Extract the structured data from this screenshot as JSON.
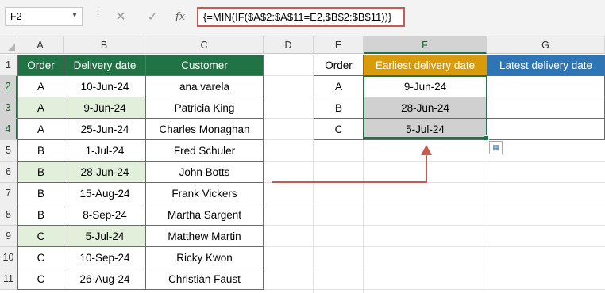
{
  "formula_bar": {
    "name_box": "F2",
    "cancel_icon": "✕",
    "enter_icon": "✓",
    "fx_label": "fx",
    "formula": "{=MIN(IF($A$2:$A$11=E2,$B$2:$B$11))}"
  },
  "columns": [
    "A",
    "B",
    "C",
    "D",
    "E",
    "F",
    "G"
  ],
  "rows": [
    "1",
    "2",
    "3",
    "4",
    "5",
    "6",
    "7",
    "8",
    "9",
    "10",
    "11"
  ],
  "left_table": {
    "headers": [
      "Order",
      "Delivery date",
      "Customer"
    ],
    "rows": [
      [
        "A",
        "10-Jun-24",
        "ana varela"
      ],
      [
        "A",
        "9-Jun-24",
        "Patricia King"
      ],
      [
        "A",
        "25-Jun-24",
        "Charles Monaghan"
      ],
      [
        "B",
        "1-Jul-24",
        "Fred Schuler"
      ],
      [
        "B",
        "28-Jun-24",
        "John Botts"
      ],
      [
        "B",
        "15-Aug-24",
        "Frank Vickers"
      ],
      [
        "B",
        "8-Sep-24",
        "Martha Sargent"
      ],
      [
        "C",
        "5-Jul-24",
        "Matthew Martin"
      ],
      [
        "C",
        "10-Sep-24",
        "Ricky Kwon"
      ],
      [
        "C",
        "26-Aug-24",
        "Christian Faust"
      ]
    ]
  },
  "right_table": {
    "headers": [
      "Order",
      "Earliest delivery date",
      "Latest delivery date"
    ],
    "rows": [
      [
        "A",
        "9-Jun-24",
        ""
      ],
      [
        "B",
        "28-Jun-24",
        ""
      ],
      [
        "C",
        "5-Jul-24",
        ""
      ]
    ]
  },
  "colors": {
    "header_green": "#217346",
    "header_orange": "#d89b0c",
    "header_blue": "#2e75b6",
    "highlight_green": "#e2efda",
    "result_gray": "#d0d0d0",
    "arrow_red": "#c65a4c"
  }
}
